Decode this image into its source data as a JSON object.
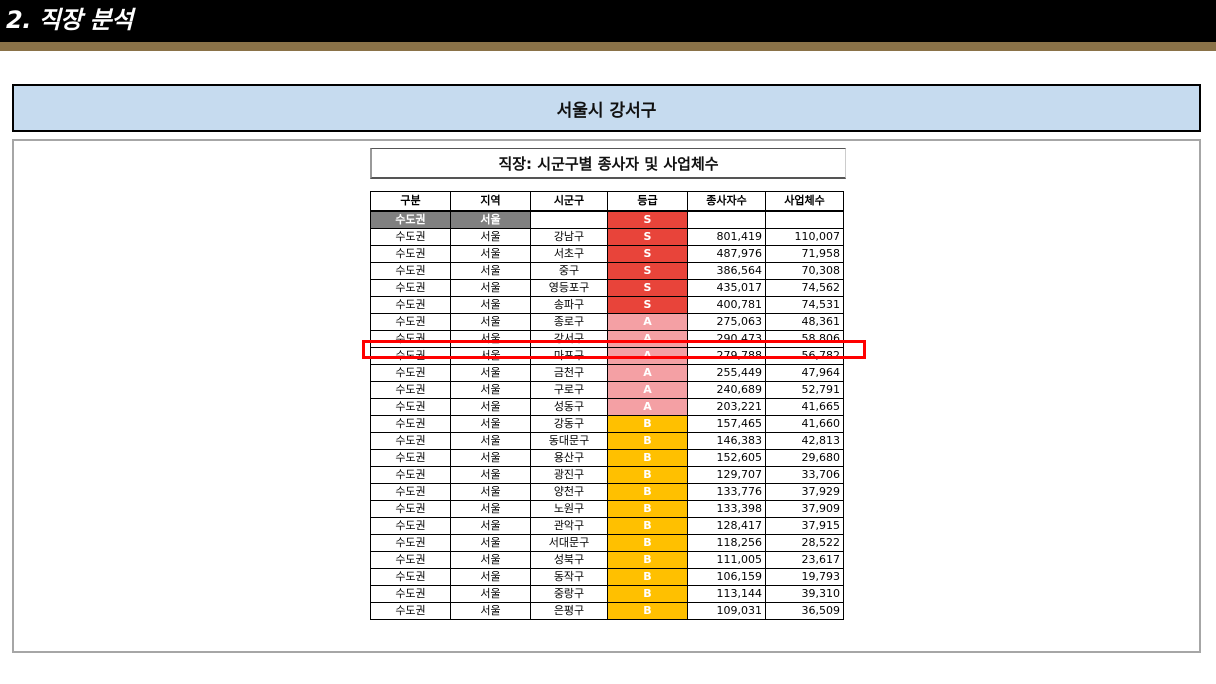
{
  "header": {
    "title": "2. 직장 분석"
  },
  "region_banner": {
    "label": "서울시 강서구"
  },
  "sheet": {
    "title": "직장: 시군구별 종사자 및 사업체수",
    "columns": [
      "구분",
      "지역",
      "시군구",
      "등급",
      "종사자수",
      "사업체수"
    ],
    "group_row": {
      "gubun": "수도권",
      "region": "서울",
      "sigungu": "",
      "grade": "S",
      "workers": "",
      "firms": ""
    },
    "rows": [
      {
        "gubun": "수도권",
        "region": "서울",
        "sigungu": "강남구",
        "grade": "S",
        "workers": "801,419",
        "firms": "110,007"
      },
      {
        "gubun": "수도권",
        "region": "서울",
        "sigungu": "서초구",
        "grade": "S",
        "workers": "487,976",
        "firms": "71,958"
      },
      {
        "gubun": "수도권",
        "region": "서울",
        "sigungu": "중구",
        "grade": "S",
        "workers": "386,564",
        "firms": "70,308"
      },
      {
        "gubun": "수도권",
        "region": "서울",
        "sigungu": "영등포구",
        "grade": "S",
        "workers": "435,017",
        "firms": "74,562"
      },
      {
        "gubun": "수도권",
        "region": "서울",
        "sigungu": "송파구",
        "grade": "S",
        "workers": "400,781",
        "firms": "74,531"
      },
      {
        "gubun": "수도권",
        "region": "서울",
        "sigungu": "종로구",
        "grade": "A",
        "workers": "275,063",
        "firms": "48,361"
      },
      {
        "gubun": "수도권",
        "region": "서울",
        "sigungu": "강서구",
        "grade": "A",
        "workers": "290,473",
        "firms": "58,806"
      },
      {
        "gubun": "수도권",
        "region": "서울",
        "sigungu": "마포구",
        "grade": "A",
        "workers": "279,788",
        "firms": "56,782"
      },
      {
        "gubun": "수도권",
        "region": "서울",
        "sigungu": "금천구",
        "grade": "A",
        "workers": "255,449",
        "firms": "47,964"
      },
      {
        "gubun": "수도권",
        "region": "서울",
        "sigungu": "구로구",
        "grade": "A",
        "workers": "240,689",
        "firms": "52,791"
      },
      {
        "gubun": "수도권",
        "region": "서울",
        "sigungu": "성동구",
        "grade": "A",
        "workers": "203,221",
        "firms": "41,665"
      },
      {
        "gubun": "수도권",
        "region": "서울",
        "sigungu": "강동구",
        "grade": "B",
        "workers": "157,465",
        "firms": "41,660"
      },
      {
        "gubun": "수도권",
        "region": "서울",
        "sigungu": "동대문구",
        "grade": "B",
        "workers": "146,383",
        "firms": "42,813"
      },
      {
        "gubun": "수도권",
        "region": "서울",
        "sigungu": "용산구",
        "grade": "B",
        "workers": "152,605",
        "firms": "29,680"
      },
      {
        "gubun": "수도권",
        "region": "서울",
        "sigungu": "광진구",
        "grade": "B",
        "workers": "129,707",
        "firms": "33,706"
      },
      {
        "gubun": "수도권",
        "region": "서울",
        "sigungu": "양천구",
        "grade": "B",
        "workers": "133,776",
        "firms": "37,929"
      },
      {
        "gubun": "수도권",
        "region": "서울",
        "sigungu": "노원구",
        "grade": "B",
        "workers": "133,398",
        "firms": "37,909"
      },
      {
        "gubun": "수도권",
        "region": "서울",
        "sigungu": "관악구",
        "grade": "B",
        "workers": "128,417",
        "firms": "37,915"
      },
      {
        "gubun": "수도권",
        "region": "서울",
        "sigungu": "서대문구",
        "grade": "B",
        "workers": "118,256",
        "firms": "28,522"
      },
      {
        "gubun": "수도권",
        "region": "서울",
        "sigungu": "성북구",
        "grade": "B",
        "workers": "111,005",
        "firms": "23,617"
      },
      {
        "gubun": "수도권",
        "region": "서울",
        "sigungu": "동작구",
        "grade": "B",
        "workers": "106,159",
        "firms": "19,793"
      },
      {
        "gubun": "수도권",
        "region": "서울",
        "sigungu": "중랑구",
        "grade": "B",
        "workers": "113,144",
        "firms": "39,310"
      },
      {
        "gubun": "수도권",
        "region": "서울",
        "sigungu": "은평구",
        "grade": "B",
        "workers": "109,031",
        "firms": "36,509"
      }
    ],
    "highlighted_sigungu": "강서구"
  },
  "colors": {
    "grade_S": "#e8443a",
    "grade_A": "#f4a0a4",
    "grade_B": "#ffc000",
    "banner_bg": "#c6dbef",
    "highlight": "#ff0000"
  }
}
